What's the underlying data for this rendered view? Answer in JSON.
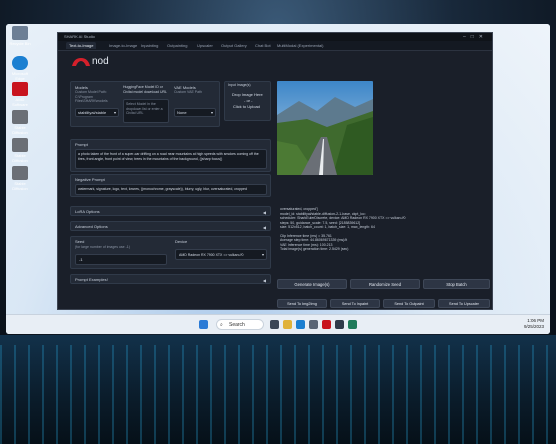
{
  "desktop": {
    "icons": [
      {
        "label": "Recycle Bin",
        "color": "#6d7f95"
      },
      {
        "label": "Microsoft Edge",
        "color": "#1b7fd1"
      },
      {
        "label": "AMD Software",
        "color": "#c8141e"
      },
      {
        "label": "Stable Diffusion",
        "color": "#6b6f76"
      },
      {
        "label": "Stable Diffusion",
        "color": "#6b6f76"
      },
      {
        "label": "Stable Diffusion",
        "color": "#6b6f76"
      }
    ]
  },
  "taskbar": {
    "search_label": "Search",
    "time": "1:06 PM",
    "date": "9/25/2023"
  },
  "window": {
    "title": "SHARK AI Studio",
    "brand": "nod",
    "tabs": [
      "Text-to-Image",
      "Image-to-Image",
      "Inpainting",
      "Outpainting",
      "Upscaler",
      "Output Gallery",
      "Chat Bot",
      "MultiModal (Experimental)"
    ],
    "models": {
      "title": "Models",
      "desc": "Custom Model Path: C:\\Program Files\\SHARK\\models",
      "value": "stabilityai/stable",
      "hf_title": "HuggingFace Model ID or Civitai model download URL",
      "hf_placeholder": "Select Model in the dropdown list or enter a Civitai URL",
      "hf_value": "",
      "vae_title": "VAE Models",
      "vae_desc": "Custom VAE Path",
      "vae_value": "None"
    },
    "input_image": {
      "title": "Input Image(s)",
      "drop": "Drop Image Here",
      "or": "- or -",
      "click": "Click to Upload"
    },
    "prompt": {
      "label": "Prompt",
      "value": "a photo taken of the front of a super-car drifting on a road near mountains at high speeds with smokes coming off the tires, front angle, front point of view, trees in the mountains of the background, ((sharp focus))"
    },
    "negative_prompt": {
      "label": "Negative Prompt",
      "value": "watermark, signature, logo, text, lowres, ((monochrome, grayscale)), blurry, ugly, blur, oversaturated, cropped"
    },
    "lora_options": "LoRA Options",
    "advanced_options": "Advanced Options",
    "seed": {
      "label": "Seed",
      "desc": "(for large number of images use -1)",
      "value": "-1"
    },
    "device": {
      "label": "Device",
      "value": "AMD Radeon RX 7900 XTX => vulkan://0"
    },
    "prompt_examples": "Prompt Examples!",
    "info": {
      "line1": "oversaturated, cropped']",
      "line2": "model_id: stabilityai/stable-diffusion-2-1-base, ckpt_loc:",
      "line3": "scheduler: SharkEulerDiscrete, device: AMD Radeon RX 7900 XTX => vulkan://0",
      "line4": "steps: 50, guidance_scale: 7.5, seed: [2185839612]",
      "line5": "size: 512x512, batch_count: 1, batch_size: 1, max_length: 64",
      "line6": "Clip Inference time (ms) = 35.761",
      "line7": "Average step time: 44.86069671339 (ms)/it",
      "line8": "VAE Inference time (ms): 100.213",
      "line9": "Total image(s) generation time: 2.5429 (sec)"
    },
    "buttons": {
      "generate": "Generate Image(s)",
      "randomize": "Randomize Seed",
      "stop": "Stop Batch",
      "send_img2img": "Send To Img2Img",
      "send_inpaint": "Send To Inpaint",
      "send_outpaint": "Send To Outpaint",
      "send_upscaler": "Send To Upscaler"
    }
  }
}
